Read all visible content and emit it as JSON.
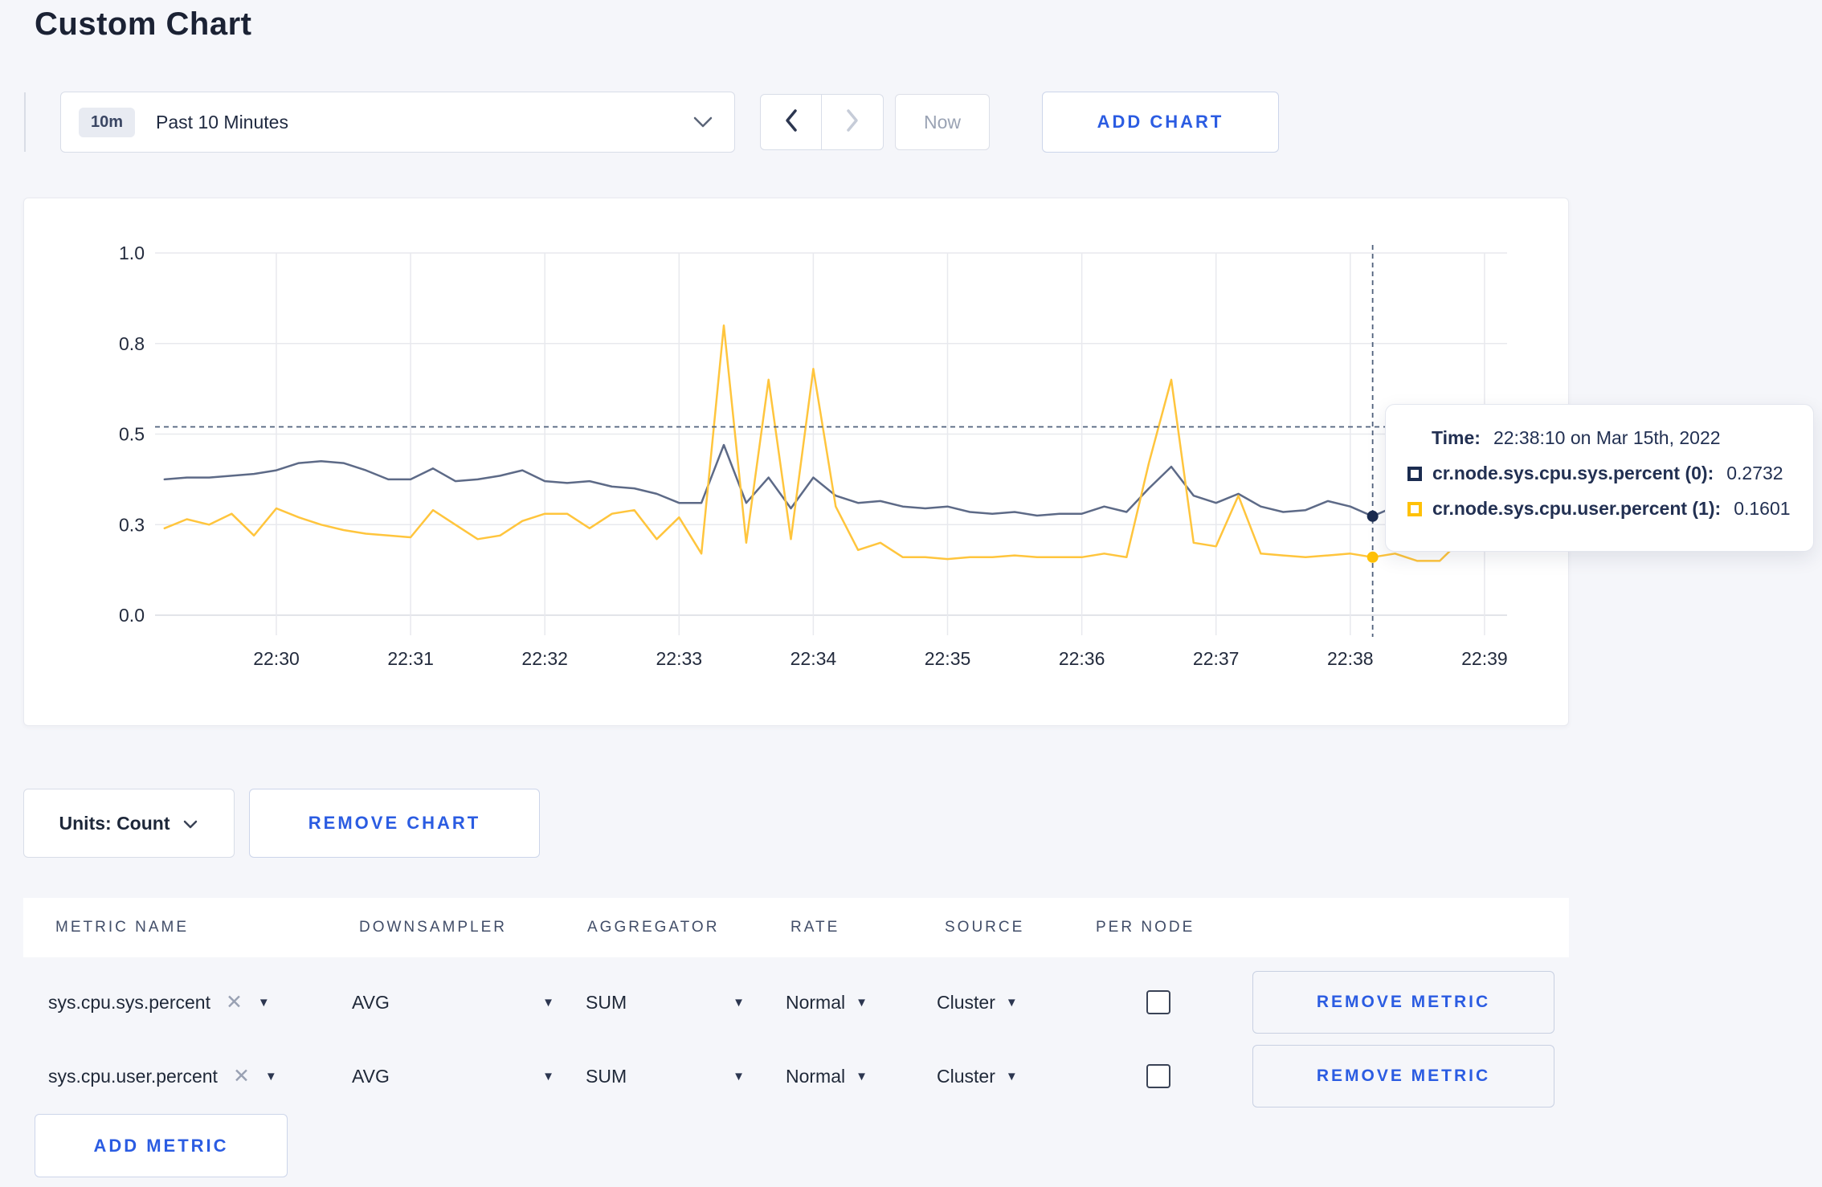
{
  "page": {
    "title": "Custom Chart"
  },
  "toolbar": {
    "time_range": {
      "badge": "10m",
      "label": "Past 10 Minutes"
    },
    "now_label": "Now",
    "add_chart_label": "ADD CHART"
  },
  "chart_data": {
    "type": "line",
    "title": "",
    "xlabel": "",
    "ylabel": "",
    "ylim": [
      0,
      1
    ],
    "grid": true,
    "x_start": "22:29:10",
    "x_end": "22:39:10",
    "interval_seconds": 10,
    "x_tick_labels": [
      "22:30",
      "22:31",
      "22:32",
      "22:33",
      "22:34",
      "22:35",
      "22:36",
      "22:37",
      "22:38",
      "22:39"
    ],
    "y_ticks": [
      {
        "value": 0.0,
        "label": "0.0"
      },
      {
        "value": 0.25,
        "label": "0.3"
      },
      {
        "value": 0.5,
        "label": "0.5"
      },
      {
        "value": 0.75,
        "label": "0.8"
      },
      {
        "value": 1.0,
        "label": "1.0"
      }
    ],
    "series": [
      {
        "name": "cr.node.sys.cpu.sys.percent",
        "line_color": "#5d6a87",
        "swatch_color": "#1b2c50",
        "values": [
          0.375,
          0.38,
          0.38,
          0.385,
          0.39,
          0.4,
          0.42,
          0.425,
          0.42,
          0.4,
          0.375,
          0.375,
          0.405,
          0.37,
          0.375,
          0.385,
          0.4,
          0.37,
          0.365,
          0.37,
          0.355,
          0.35,
          0.335,
          0.31,
          0.31,
          0.47,
          0.31,
          0.38,
          0.295,
          0.38,
          0.33,
          0.31,
          0.315,
          0.3,
          0.295,
          0.3,
          0.285,
          0.28,
          0.285,
          0.275,
          0.28,
          0.28,
          0.3,
          0.285,
          0.35,
          0.41,
          0.33,
          0.31,
          0.335,
          0.3,
          0.285,
          0.29,
          0.315,
          0.3,
          0.2732,
          0.3,
          0.295,
          0.29,
          0.3,
          0.29,
          0.28
        ]
      },
      {
        "name": "cr.node.sys.cpu.user.percent",
        "line_color": "#ffc53d",
        "swatch_color": "#ffc107",
        "values": [
          0.24,
          0.265,
          0.25,
          0.28,
          0.22,
          0.295,
          0.27,
          0.25,
          0.235,
          0.225,
          0.22,
          0.215,
          0.29,
          0.25,
          0.21,
          0.22,
          0.26,
          0.28,
          0.28,
          0.24,
          0.28,
          0.29,
          0.21,
          0.27,
          0.17,
          0.8,
          0.2,
          0.65,
          0.21,
          0.68,
          0.3,
          0.18,
          0.2,
          0.16,
          0.16,
          0.155,
          0.16,
          0.16,
          0.165,
          0.16,
          0.16,
          0.16,
          0.17,
          0.16,
          0.42,
          0.65,
          0.2,
          0.19,
          0.33,
          0.17,
          0.165,
          0.16,
          0.165,
          0.17,
          0.1601,
          0.17,
          0.15,
          0.15,
          0.21,
          0.275,
          0.24
        ]
      }
    ],
    "crosshair": {
      "time": "22:38:10",
      "index": 54,
      "y_value": 0.52
    }
  },
  "tooltip": {
    "time_label": "Time:",
    "time_value": "22:38:10 on Mar 15th, 2022",
    "rows": [
      {
        "label": "cr.node.sys.cpu.sys.percent (0):",
        "value": "0.2732"
      },
      {
        "label": "cr.node.sys.cpu.user.percent (1):",
        "value": "0.1601"
      }
    ]
  },
  "units": {
    "label": "Units: Count"
  },
  "remove_chart_label": "REMOVE CHART",
  "metrics_table": {
    "headers": [
      "METRIC NAME",
      "DOWNSAMPLER",
      "AGGREGATOR",
      "RATE",
      "SOURCE",
      "PER NODE"
    ],
    "remove_metric_label": "REMOVE METRIC",
    "add_metric_label": "ADD METRIC",
    "rows": [
      {
        "metric": "sys.cpu.sys.percent",
        "downsampler": "AVG",
        "aggregator": "SUM",
        "rate": "Normal",
        "source": "Cluster",
        "per_node_checked": false
      },
      {
        "metric": "sys.cpu.user.percent",
        "downsampler": "AVG",
        "aggregator": "SUM",
        "rate": "Normal",
        "source": "Cluster",
        "per_node_checked": false
      }
    ]
  },
  "icons": {
    "close": "✕",
    "caret_down": "▼"
  }
}
